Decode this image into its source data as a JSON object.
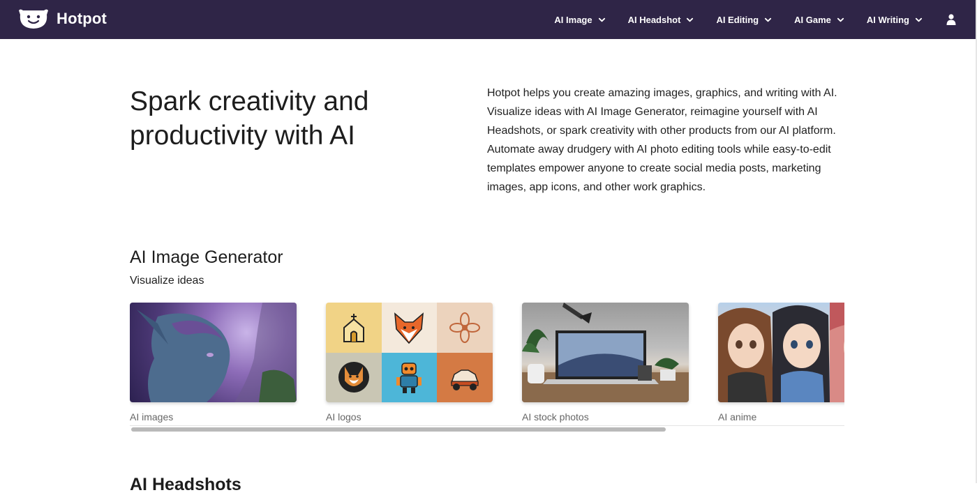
{
  "brand": {
    "name": "Hotpot"
  },
  "nav": {
    "items": [
      {
        "label": "AI Image"
      },
      {
        "label": "AI Headshot"
      },
      {
        "label": "AI Editing"
      },
      {
        "label": "AI Game"
      },
      {
        "label": "AI Writing"
      }
    ],
    "user_icon": "user-icon"
  },
  "hero": {
    "title": "Spark creativity and productivity with AI",
    "description": "Hotpot helps you create amazing images, graphics, and writing with AI. Visualize ideas with AI Image Generator, reimagine yourself with AI Headshots, or spark creativity with other products from our AI platform. Automate away drudgery with AI photo editing tools while easy-to-edit templates empower anyone to create social media posts, marketing images, app icons, and other work graphics."
  },
  "section": {
    "title": "AI Image Generator",
    "subtitle": "Visualize ideas",
    "cards": [
      {
        "label": "AI images"
      },
      {
        "label": "AI logos"
      },
      {
        "label": "AI stock photos"
      },
      {
        "label": "AI anime"
      }
    ]
  },
  "next_section": {
    "title": "AI Headshots"
  },
  "colors": {
    "nav_bg": "#2f2547",
    "text": "#1d1d1d",
    "muted": "#666666"
  }
}
